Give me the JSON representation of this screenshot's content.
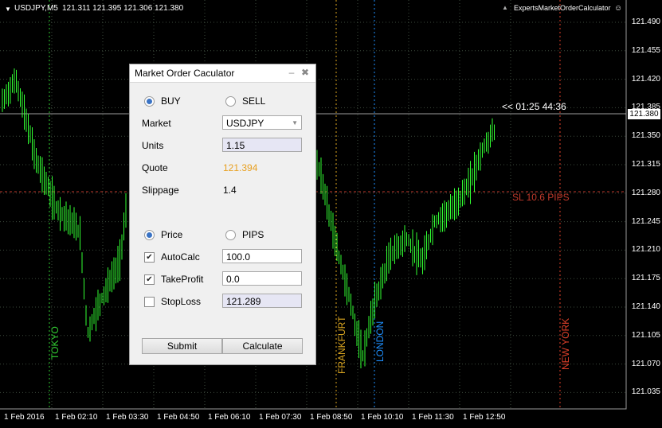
{
  "chart": {
    "symbol_label": "USDJPY,M5",
    "ohlc_label": "121.311 121.395 121.306 121.380",
    "expert_label": "ExpertsMarketOrderCalculator",
    "timer_label": "<< 01:25  44:36",
    "sl_label": "SL 10.6 PIPS",
    "current_price": "121.380",
    "price_axis": [
      "121.490",
      "121.455",
      "121.420",
      "121.385",
      "121.350",
      "121.315",
      "121.280",
      "121.245",
      "121.210",
      "121.175",
      "121.140",
      "121.105",
      "121.070",
      "121.035"
    ],
    "time_axis": [
      "1 Feb 2016",
      "1 Feb 02:10",
      "1 Feb 03:30",
      "1 Feb 04:50",
      "1 Feb 06:10",
      "1 Feb 07:30",
      "1 Feb 08:50",
      "1 Feb 10:10",
      "1 Feb 11:30",
      "1 Feb 12:50"
    ],
    "sessions": [
      {
        "label": "TOKYO",
        "color": "#32cd32"
      },
      {
        "label": "FRANKFURT",
        "color": "#daa520"
      },
      {
        "label": "LONDON",
        "color": "#1e90ff"
      },
      {
        "label": "NEW YORK",
        "color": "#e0402a"
      }
    ],
    "colors": {
      "candles": "#32ff32",
      "grid": "#3c4a3c",
      "sl_line": "#c0392b",
      "price_line": "#cfcfcf",
      "timer": "#ffffff",
      "sl_text": "#c0392b"
    }
  },
  "dialog": {
    "title": "Market Order Caculator",
    "minimize_icon": "–",
    "close_icon": "✖",
    "buy_label": "BUY",
    "sell_label": "SELL",
    "market_label": "Market",
    "market_value": "USDJPY",
    "units_label": "Units",
    "units_value": "1.15",
    "quote_label": "Quote",
    "quote_value": "121.394",
    "quote_color": "#e8a020",
    "slippage_label": "Slippage",
    "slippage_value": "1.4",
    "price_label": "Price",
    "pips_label": "PIPS",
    "autocalc_label": "AutoCalc",
    "autocalc_value": "100.0",
    "takeprofit_label": "TakeProfit",
    "takeprofit_value": "0.0",
    "stoploss_label": "StopLoss",
    "stoploss_value": "121.289",
    "submit_label": "Submit",
    "calculate_label": "Calculate"
  }
}
